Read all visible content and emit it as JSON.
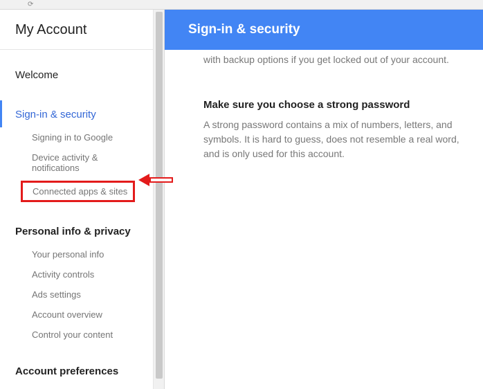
{
  "page_title": "My Account",
  "header_title": "Sign-in & security",
  "sidebar": {
    "welcome": "Welcome",
    "sign_in_security": "Sign-in & security",
    "signin_sub": {
      "signing_in": "Signing in to Google",
      "device_activity": "Device activity & notifications",
      "connected_apps": "Connected apps & sites"
    },
    "personal_info": "Personal info & privacy",
    "personal_sub": {
      "your_info": "Your personal info",
      "activity": "Activity controls",
      "ads": "Ads settings",
      "overview": "Account overview",
      "control": "Control your content"
    },
    "account_prefs": "Account preferences"
  },
  "content": {
    "truncated": "with backup options if you get locked out of your account.",
    "strong_heading": "Make sure you choose a strong password",
    "strong_body": "A strong password contains a mix of numbers, letters, and symbols. It is hard to guess, does not resemble a real word, and is only used for this account."
  }
}
